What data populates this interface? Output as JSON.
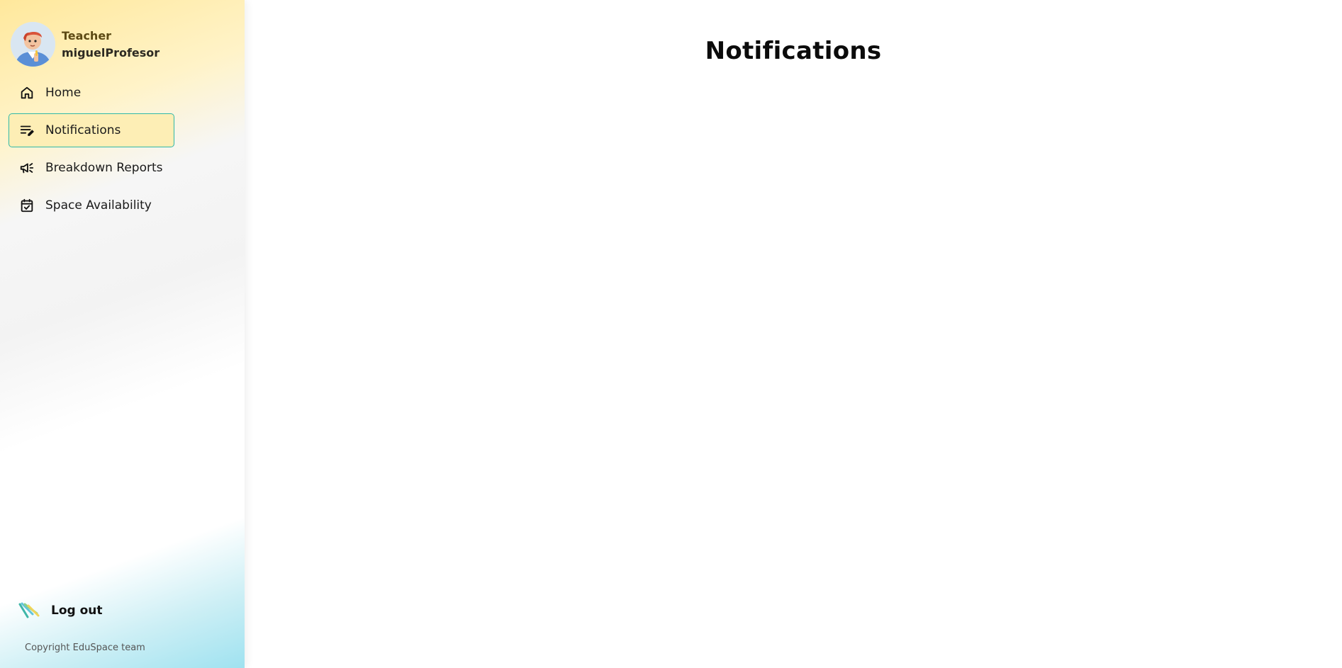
{
  "profile": {
    "role": "Teacher",
    "username": "miguelProfesor"
  },
  "nav": {
    "items": [
      {
        "label": "Home",
        "icon": "home-icon",
        "active": false
      },
      {
        "label": "Notifications",
        "icon": "edit-list-icon",
        "active": true
      },
      {
        "label": "Breakdown Reports",
        "icon": "megaphone-icon",
        "active": false
      },
      {
        "label": "Space Availability",
        "icon": "calendar-check-icon",
        "active": false
      }
    ]
  },
  "logout": {
    "label": "Log out",
    "icon": "stripes-logo-icon"
  },
  "footer": {
    "copyright": "Copyright EduSpace team"
  },
  "main": {
    "title": "Notifications"
  },
  "colors": {
    "active_bg": "#fdeeb5",
    "active_border": "#2fb8a8",
    "sidebar_top": "#ffe89c",
    "sidebar_bottom": "#9fe2f0"
  }
}
